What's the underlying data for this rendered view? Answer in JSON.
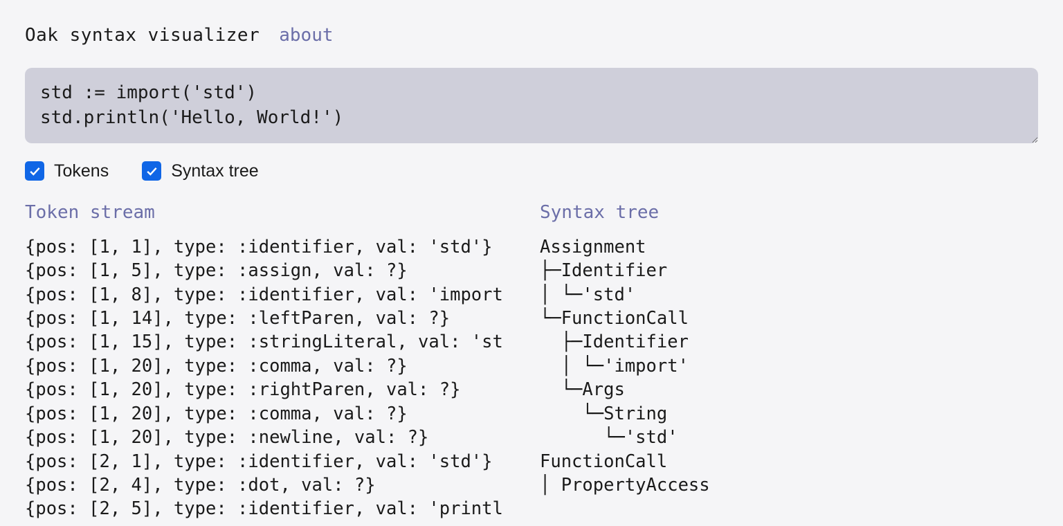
{
  "header": {
    "title": "Oak syntax visualizer",
    "about_label": "about"
  },
  "code_input": {
    "value": "std := import('std')\nstd.println('Hello, World!')"
  },
  "controls": {
    "tokens": {
      "label": "Tokens",
      "checked": true
    },
    "syntax_tree": {
      "label": "Syntax tree",
      "checked": true
    }
  },
  "panels": {
    "tokens": {
      "heading": "Token stream",
      "lines": [
        "{pos: [1, 1], type: :identifier, val: 'std'}",
        "{pos: [1, 5], type: :assign, val: ?}",
        "{pos: [1, 8], type: :identifier, val: 'import",
        "{pos: [1, 14], type: :leftParen, val: ?}",
        "{pos: [1, 15], type: :stringLiteral, val: 'st",
        "{pos: [1, 20], type: :comma, val: ?}",
        "{pos: [1, 20], type: :rightParen, val: ?}",
        "{pos: [1, 20], type: :comma, val: ?}",
        "{pos: [1, 20], type: :newline, val: ?}",
        "{pos: [2, 1], type: :identifier, val: 'std'}",
        "{pos: [2, 4], type: :dot, val: ?}",
        "{pos: [2, 5], type: :identifier, val: 'printl"
      ]
    },
    "syntax": {
      "heading": "Syntax tree",
      "lines": [
        "Assignment",
        "├─Identifier",
        "│ └─'std'",
        "└─FunctionCall",
        "  ├─Identifier",
        "  │ └─'import'",
        "  └─Args",
        "    └─String",
        "      └─'std'",
        "FunctionCall",
        "│ PropertyAccess"
      ]
    }
  }
}
